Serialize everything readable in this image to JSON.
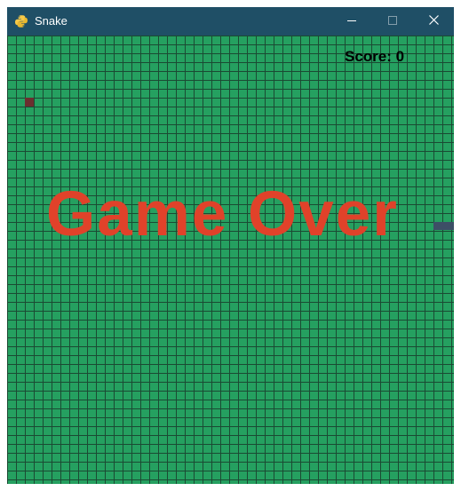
{
  "window": {
    "title": "Snake",
    "icon": "python-snake-icon",
    "controls": {
      "minimize": "minimize-icon",
      "maximize": "maximize-icon",
      "close": "close-icon"
    },
    "titlebar_color": "#1f4f66"
  },
  "game": {
    "score_text": "Score: 0",
    "game_over_text": "Game Over",
    "colors": {
      "board": "#25a060",
      "grid_lines": "#1b4a33",
      "food": "#6b2f2f",
      "snake": "#3d4f66",
      "game_over_text": "#e0422a",
      "score_text": "#000000"
    }
  }
}
